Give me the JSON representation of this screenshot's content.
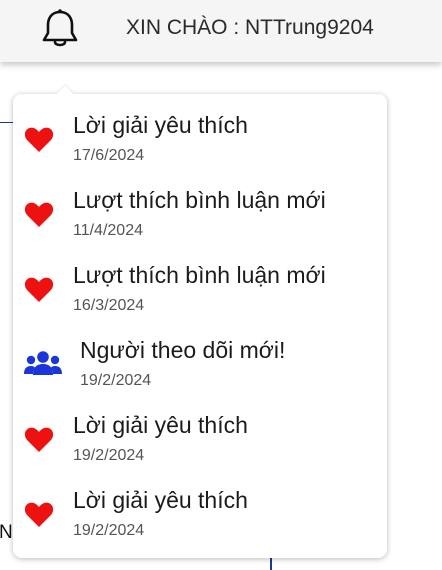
{
  "header": {
    "greeting": "XIN CHÀO : NTTrung9204",
    "bell_icon": "bell-icon"
  },
  "page": {
    "fragment_text": "N"
  },
  "colors": {
    "heart": "#ee1111",
    "users": "#1a36d8"
  },
  "notifications": [
    {
      "icon": "heart-icon",
      "title": "Lời giải yêu thích",
      "date": "17/6/2024"
    },
    {
      "icon": "heart-icon",
      "title": "Lượt thích bình luận mới",
      "date": "11/4/2024"
    },
    {
      "icon": "heart-icon",
      "title": "Lượt thích bình luận mới",
      "date": "16/3/2024"
    },
    {
      "icon": "users-icon",
      "title": "Người theo dõi mới!",
      "date": "19/2/2024"
    },
    {
      "icon": "heart-icon",
      "title": "Lời giải yêu thích",
      "date": "19/2/2024"
    },
    {
      "icon": "heart-icon",
      "title": "Lời giải yêu thích",
      "date": "19/2/2024"
    }
  ]
}
